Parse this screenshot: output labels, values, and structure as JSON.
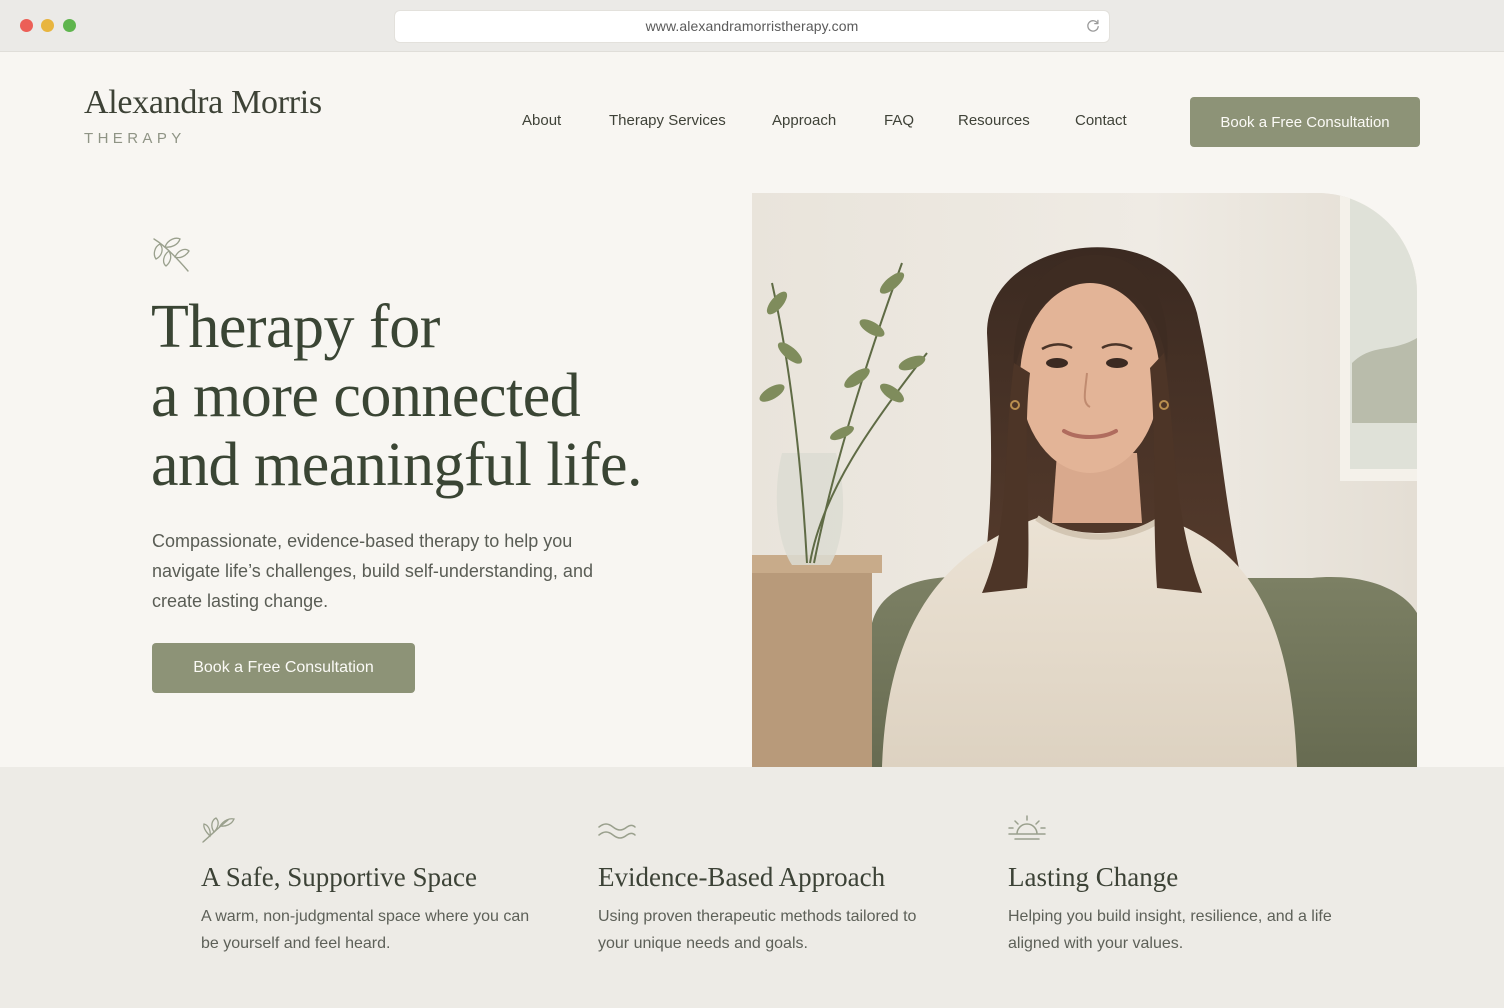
{
  "browser": {
    "url": "www.alexandramorristherapy.com"
  },
  "header": {
    "logo_name": "Alexandra Morris",
    "logo_sub": "THERAPY",
    "nav": [
      "About",
      "Therapy Services",
      "Approach",
      "FAQ",
      "Resources",
      "Contact"
    ],
    "cta_label": "Book a Free Consultation"
  },
  "hero": {
    "title_lines": [
      "Therapy for",
      "a more connected",
      "and meaningful life."
    ],
    "description": "Compassionate, evidence-based therapy to help you navigate life’s challenges, build self-understanding, and create lasting change.",
    "cta_label": "Book a Free Consultation"
  },
  "features": [
    {
      "icon": "leaf-icon",
      "title": "A Safe, Supportive Space",
      "description": "A warm, non-judgmental space where you can be yourself and feel heard."
    },
    {
      "icon": "waves-icon",
      "title": "Evidence-Based Approach",
      "description": "Using proven therapeutic methods tailored to your unique needs and goals."
    },
    {
      "icon": "sunrise-icon",
      "title": "Lasting Change",
      "description": "Helping you build insight, resilience, and a life aligned with your values."
    }
  ],
  "colors": {
    "accent": "#8d9377",
    "heading": "#3a4534",
    "background": "#f8f6f2",
    "band": "#edebe6"
  }
}
